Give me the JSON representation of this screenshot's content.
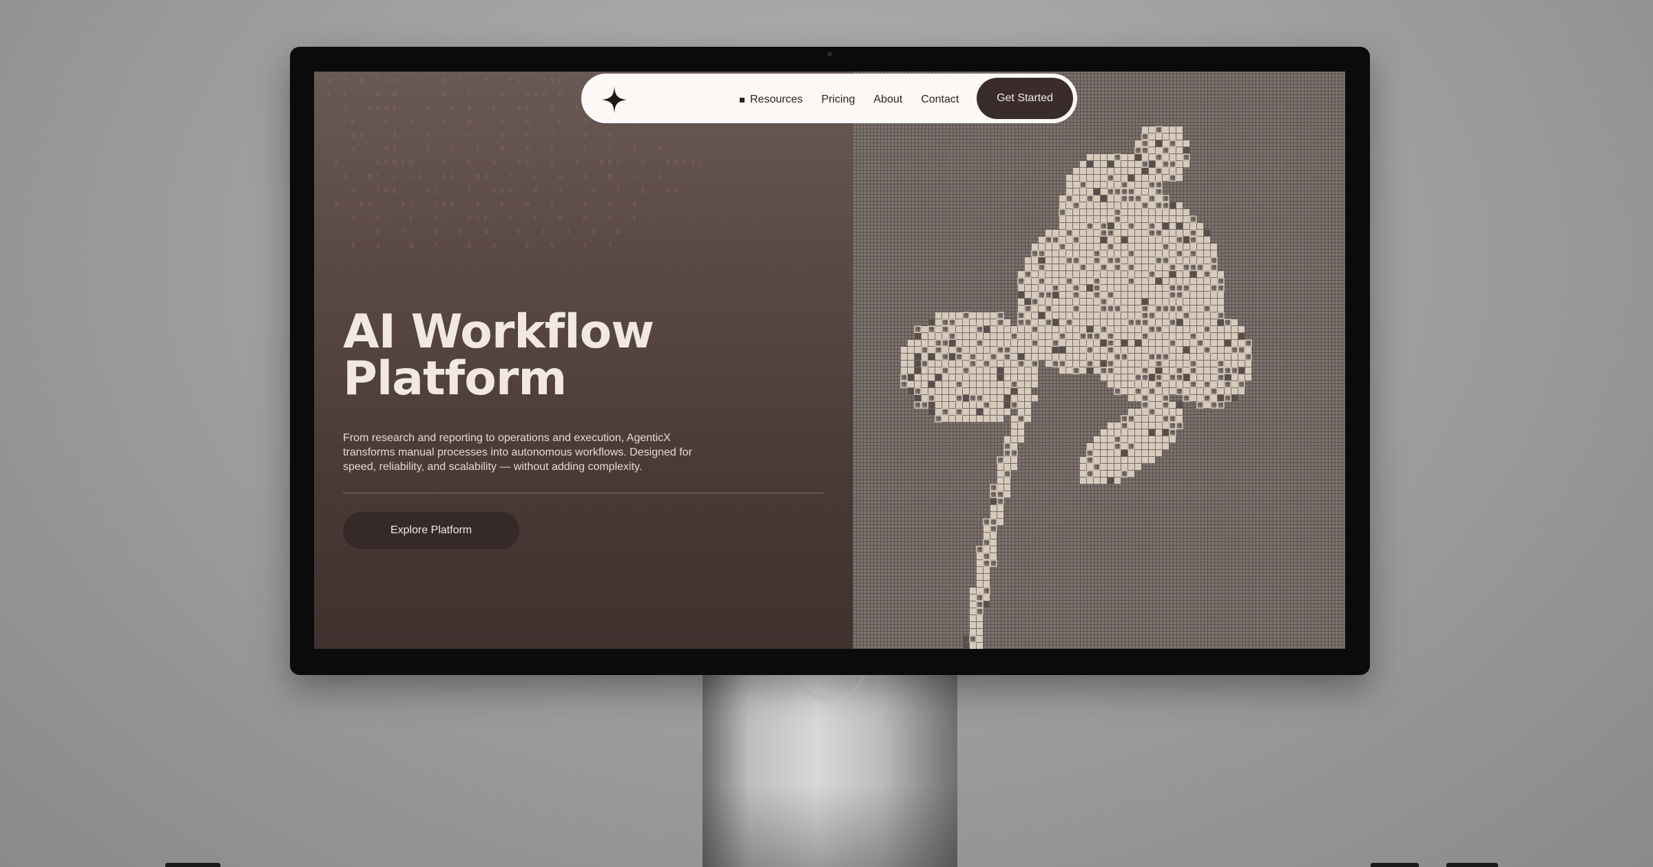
{
  "nav": {
    "links": [
      {
        "label": "Resources",
        "icon": "square-icon"
      },
      {
        "label": "Pricing"
      },
      {
        "label": "About"
      },
      {
        "label": "Contact"
      }
    ],
    "cta_label": "Get Started",
    "logo_icon": "four-point-star-icon"
  },
  "hero": {
    "title_line1": "AI Workflow",
    "title_line2": "Platform",
    "description": "From research and reporting to operations and execution, AgenticX transforms manual processes into autonomous workflows. Designed for speed, reliability, and scalability — without adding complexity.",
    "button_label": "Explore Platform"
  },
  "art": {
    "subject": "pixelated-flower",
    "petal_color": "#d8cbbd",
    "grid_color": "#7c716c"
  },
  "colors": {
    "hero_bg": "#4a3a36",
    "button_dark": "#362a28",
    "nav_bg": "#fbf8f6",
    "text_light": "#f2e8e2"
  }
}
